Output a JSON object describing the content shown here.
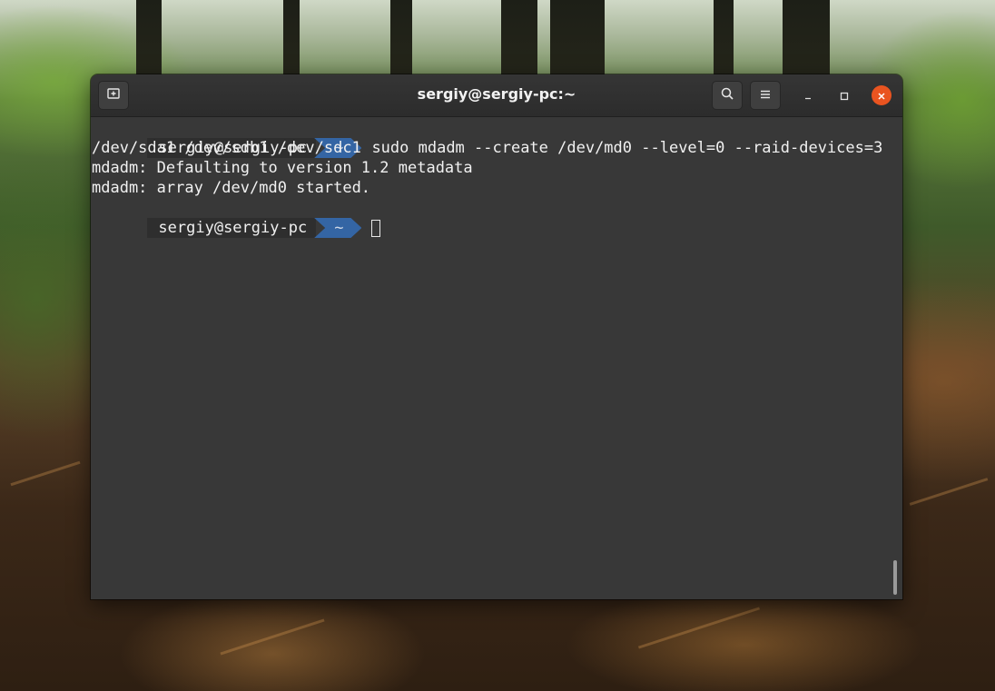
{
  "window": {
    "title": "sergiy@sergiy-pc:~"
  },
  "titlebar": {
    "new_tab_icon": "new-tab-icon",
    "search_icon": "search-icon",
    "menu_icon": "hamburger-menu-icon",
    "minimize_icon": "minimize-icon",
    "maximize_icon": "maximize-icon",
    "close_icon": "close-icon",
    "close_color": "#e95420"
  },
  "terminal": {
    "background": "#383838",
    "prompt_dir_color": "#3465a4",
    "prompt1": {
      "user": "sergiy@sergiy-pc",
      "dir": "~",
      "command": "sudo mdadm --create /dev/md0 --level=0 --raid-devices=3"
    },
    "output": [
      "/dev/sda1 /dev/sdb1 /dev/sdc1",
      "mdadm: Defaulting to version 1.2 metadata",
      "mdadm: array /dev/md0 started."
    ],
    "prompt2": {
      "user": "sergiy@sergiy-pc",
      "dir": "~"
    }
  }
}
